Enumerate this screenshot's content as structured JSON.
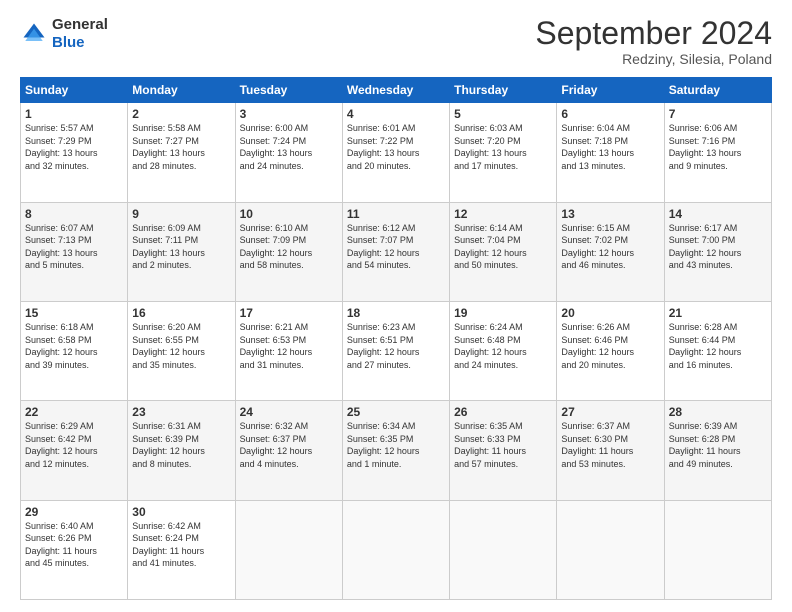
{
  "header": {
    "logo_general": "General",
    "logo_blue": "Blue",
    "month_title": "September 2024",
    "location": "Redziny, Silesia, Poland"
  },
  "weekdays": [
    "Sunday",
    "Monday",
    "Tuesday",
    "Wednesday",
    "Thursday",
    "Friday",
    "Saturday"
  ],
  "weeks": [
    [
      {
        "day": "1",
        "info": "Sunrise: 5:57 AM\nSunset: 7:29 PM\nDaylight: 13 hours\nand 32 minutes."
      },
      {
        "day": "2",
        "info": "Sunrise: 5:58 AM\nSunset: 7:27 PM\nDaylight: 13 hours\nand 28 minutes."
      },
      {
        "day": "3",
        "info": "Sunrise: 6:00 AM\nSunset: 7:24 PM\nDaylight: 13 hours\nand 24 minutes."
      },
      {
        "day": "4",
        "info": "Sunrise: 6:01 AM\nSunset: 7:22 PM\nDaylight: 13 hours\nand 20 minutes."
      },
      {
        "day": "5",
        "info": "Sunrise: 6:03 AM\nSunset: 7:20 PM\nDaylight: 13 hours\nand 17 minutes."
      },
      {
        "day": "6",
        "info": "Sunrise: 6:04 AM\nSunset: 7:18 PM\nDaylight: 13 hours\nand 13 minutes."
      },
      {
        "day": "7",
        "info": "Sunrise: 6:06 AM\nSunset: 7:16 PM\nDaylight: 13 hours\nand 9 minutes."
      }
    ],
    [
      {
        "day": "8",
        "info": "Sunrise: 6:07 AM\nSunset: 7:13 PM\nDaylight: 13 hours\nand 5 minutes."
      },
      {
        "day": "9",
        "info": "Sunrise: 6:09 AM\nSunset: 7:11 PM\nDaylight: 13 hours\nand 2 minutes."
      },
      {
        "day": "10",
        "info": "Sunrise: 6:10 AM\nSunset: 7:09 PM\nDaylight: 12 hours\nand 58 minutes."
      },
      {
        "day": "11",
        "info": "Sunrise: 6:12 AM\nSunset: 7:07 PM\nDaylight: 12 hours\nand 54 minutes."
      },
      {
        "day": "12",
        "info": "Sunrise: 6:14 AM\nSunset: 7:04 PM\nDaylight: 12 hours\nand 50 minutes."
      },
      {
        "day": "13",
        "info": "Sunrise: 6:15 AM\nSunset: 7:02 PM\nDaylight: 12 hours\nand 46 minutes."
      },
      {
        "day": "14",
        "info": "Sunrise: 6:17 AM\nSunset: 7:00 PM\nDaylight: 12 hours\nand 43 minutes."
      }
    ],
    [
      {
        "day": "15",
        "info": "Sunrise: 6:18 AM\nSunset: 6:58 PM\nDaylight: 12 hours\nand 39 minutes."
      },
      {
        "day": "16",
        "info": "Sunrise: 6:20 AM\nSunset: 6:55 PM\nDaylight: 12 hours\nand 35 minutes."
      },
      {
        "day": "17",
        "info": "Sunrise: 6:21 AM\nSunset: 6:53 PM\nDaylight: 12 hours\nand 31 minutes."
      },
      {
        "day": "18",
        "info": "Sunrise: 6:23 AM\nSunset: 6:51 PM\nDaylight: 12 hours\nand 27 minutes."
      },
      {
        "day": "19",
        "info": "Sunrise: 6:24 AM\nSunset: 6:48 PM\nDaylight: 12 hours\nand 24 minutes."
      },
      {
        "day": "20",
        "info": "Sunrise: 6:26 AM\nSunset: 6:46 PM\nDaylight: 12 hours\nand 20 minutes."
      },
      {
        "day": "21",
        "info": "Sunrise: 6:28 AM\nSunset: 6:44 PM\nDaylight: 12 hours\nand 16 minutes."
      }
    ],
    [
      {
        "day": "22",
        "info": "Sunrise: 6:29 AM\nSunset: 6:42 PM\nDaylight: 12 hours\nand 12 minutes."
      },
      {
        "day": "23",
        "info": "Sunrise: 6:31 AM\nSunset: 6:39 PM\nDaylight: 12 hours\nand 8 minutes."
      },
      {
        "day": "24",
        "info": "Sunrise: 6:32 AM\nSunset: 6:37 PM\nDaylight: 12 hours\nand 4 minutes."
      },
      {
        "day": "25",
        "info": "Sunrise: 6:34 AM\nSunset: 6:35 PM\nDaylight: 12 hours\nand 1 minute."
      },
      {
        "day": "26",
        "info": "Sunrise: 6:35 AM\nSunset: 6:33 PM\nDaylight: 11 hours\nand 57 minutes."
      },
      {
        "day": "27",
        "info": "Sunrise: 6:37 AM\nSunset: 6:30 PM\nDaylight: 11 hours\nand 53 minutes."
      },
      {
        "day": "28",
        "info": "Sunrise: 6:39 AM\nSunset: 6:28 PM\nDaylight: 11 hours\nand 49 minutes."
      }
    ],
    [
      {
        "day": "29",
        "info": "Sunrise: 6:40 AM\nSunset: 6:26 PM\nDaylight: 11 hours\nand 45 minutes."
      },
      {
        "day": "30",
        "info": "Sunrise: 6:42 AM\nSunset: 6:24 PM\nDaylight: 11 hours\nand 41 minutes."
      },
      {
        "day": "",
        "info": ""
      },
      {
        "day": "",
        "info": ""
      },
      {
        "day": "",
        "info": ""
      },
      {
        "day": "",
        "info": ""
      },
      {
        "day": "",
        "info": ""
      }
    ]
  ]
}
